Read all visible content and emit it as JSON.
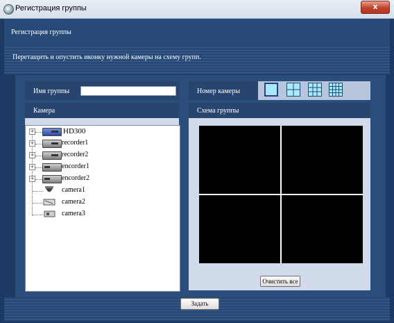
{
  "window": {
    "title": "Регистрация группы",
    "close_glyph": "x",
    "app_icon": "camera-app-icon"
  },
  "header": {
    "title": "Регистрация группы"
  },
  "instruction": "Перетащить и опустить иконку нужной камеры на схему групп.",
  "group_name": {
    "label": "Имя группы",
    "value": ""
  },
  "camera_number": {
    "label": "Номер камеры",
    "layouts": [
      "1-screen",
      "4-screen",
      "9-screen",
      "16-screen"
    ],
    "selected": "1-screen"
  },
  "camera_panel": {
    "title": "Камера"
  },
  "tree": {
    "items": [
      {
        "label": "HD300",
        "type": "device",
        "icon": "recorder-blue-icon",
        "expandable": true
      },
      {
        "label": "recorder1",
        "type": "device",
        "icon": "recorder-icon",
        "expandable": true
      },
      {
        "label": "recorder2",
        "type": "device",
        "icon": "recorder-icon",
        "expandable": true
      },
      {
        "label": "encorder1",
        "type": "device",
        "icon": "encoder-icon",
        "expandable": true
      },
      {
        "label": "encorder2",
        "type": "device",
        "icon": "encoder-icon",
        "expandable": true
      },
      {
        "label": "camera1",
        "type": "camera",
        "icon": "dome-camera-icon",
        "expandable": false
      },
      {
        "label": "camera2",
        "type": "camera",
        "icon": "box-camera-icon",
        "expandable": false
      },
      {
        "label": "camera3",
        "type": "camera",
        "icon": "bullet-camera-icon",
        "expandable": false
      }
    ]
  },
  "group_map": {
    "title": "Схема группы",
    "cells": 4
  },
  "buttons": {
    "clear_all": "Очистить все",
    "set": "Задать"
  },
  "colors": {
    "background": "#1d3a64",
    "panel": "#2b4d7c",
    "accent": "#a9e9fb",
    "close": "#c0412a"
  }
}
